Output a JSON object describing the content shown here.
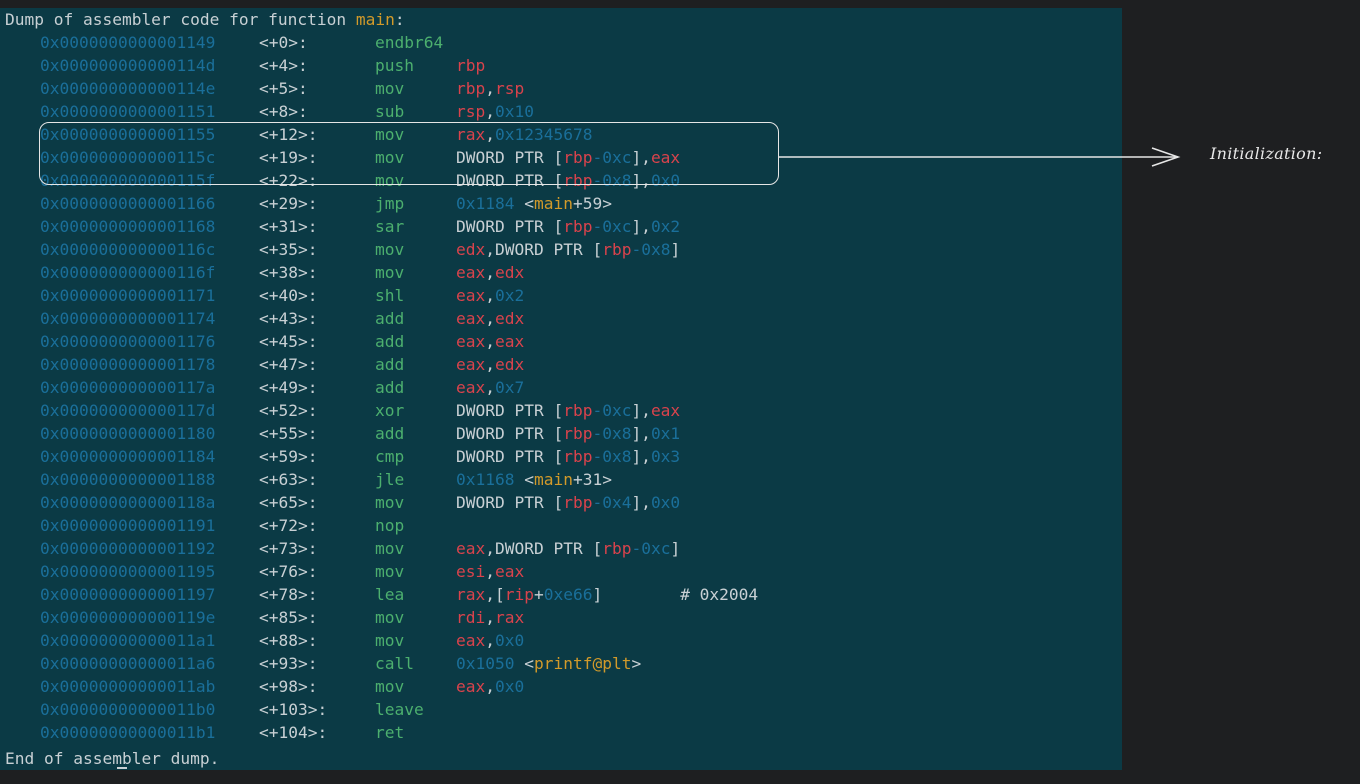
{
  "header": {
    "prefix": "Dump of assembler code for function ",
    "function_name": "main",
    "suffix": ":"
  },
  "footer": "End of assembler dump.",
  "annotation": {
    "label": "Initialization:"
  },
  "rows": [
    {
      "addr": "0x0000000000001149",
      "off": "<+0>:",
      "mn": "endbr64",
      "ops": []
    },
    {
      "addr": "0x000000000000114d",
      "off": "<+4>:",
      "mn": "push",
      "ops": [
        [
          "r",
          "rbp"
        ]
      ]
    },
    {
      "addr": "0x000000000000114e",
      "off": "<+5>:",
      "mn": "mov",
      "ops": [
        [
          "r",
          "rbp"
        ],
        [
          "p",
          ","
        ],
        [
          "r",
          "rsp"
        ]
      ]
    },
    {
      "addr": "0x0000000000001151",
      "off": "<+8>:",
      "mn": "sub",
      "ops": [
        [
          "r",
          "rsp"
        ],
        [
          "p",
          ","
        ],
        [
          "i",
          "0x10"
        ]
      ]
    },
    {
      "addr": "0x0000000000001155",
      "off": "<+12>:",
      "mn": "mov",
      "ops": [
        [
          "r",
          "rax"
        ],
        [
          "p",
          ","
        ],
        [
          "i",
          "0x12345678"
        ]
      ]
    },
    {
      "addr": "0x000000000000115c",
      "off": "<+19>:",
      "mn": "mov",
      "ops": [
        [
          "p",
          "DWORD PTR ["
        ],
        [
          "r",
          "rbp"
        ],
        [
          "i",
          "-0xc"
        ],
        [
          "p",
          "],"
        ],
        [
          "r",
          "eax"
        ]
      ]
    },
    {
      "addr": "0x000000000000115f",
      "off": "<+22>:",
      "mn": "mov",
      "ops": [
        [
          "p",
          "DWORD PTR ["
        ],
        [
          "r",
          "rbp"
        ],
        [
          "i",
          "-0x8"
        ],
        [
          "p",
          "],"
        ],
        [
          "i",
          "0x0"
        ]
      ]
    },
    {
      "addr": "0x0000000000001166",
      "off": "<+29>:",
      "mn": "jmp",
      "ops": [
        [
          "i",
          "0x1184"
        ],
        [
          "p",
          " <"
        ],
        [
          "f",
          "main"
        ],
        [
          "p",
          "+59>"
        ]
      ]
    },
    {
      "addr": "0x0000000000001168",
      "off": "<+31>:",
      "mn": "sar",
      "ops": [
        [
          "p",
          "DWORD PTR ["
        ],
        [
          "r",
          "rbp"
        ],
        [
          "i",
          "-0xc"
        ],
        [
          "p",
          "],"
        ],
        [
          "i",
          "0x2"
        ]
      ]
    },
    {
      "addr": "0x000000000000116c",
      "off": "<+35>:",
      "mn": "mov",
      "ops": [
        [
          "r",
          "edx"
        ],
        [
          "p",
          ",DWORD PTR ["
        ],
        [
          "r",
          "rbp"
        ],
        [
          "i",
          "-0x8"
        ],
        [
          "p",
          "]"
        ]
      ]
    },
    {
      "addr": "0x000000000000116f",
      "off": "<+38>:",
      "mn": "mov",
      "ops": [
        [
          "r",
          "eax"
        ],
        [
          "p",
          ","
        ],
        [
          "r",
          "edx"
        ]
      ]
    },
    {
      "addr": "0x0000000000001171",
      "off": "<+40>:",
      "mn": "shl",
      "ops": [
        [
          "r",
          "eax"
        ],
        [
          "p",
          ","
        ],
        [
          "i",
          "0x2"
        ]
      ]
    },
    {
      "addr": "0x0000000000001174",
      "off": "<+43>:",
      "mn": "add",
      "ops": [
        [
          "r",
          "eax"
        ],
        [
          "p",
          ","
        ],
        [
          "r",
          "edx"
        ]
      ]
    },
    {
      "addr": "0x0000000000001176",
      "off": "<+45>:",
      "mn": "add",
      "ops": [
        [
          "r",
          "eax"
        ],
        [
          "p",
          ","
        ],
        [
          "r",
          "eax"
        ]
      ]
    },
    {
      "addr": "0x0000000000001178",
      "off": "<+47>:",
      "mn": "add",
      "ops": [
        [
          "r",
          "eax"
        ],
        [
          "p",
          ","
        ],
        [
          "r",
          "edx"
        ]
      ]
    },
    {
      "addr": "0x000000000000117a",
      "off": "<+49>:",
      "mn": "add",
      "ops": [
        [
          "r",
          "eax"
        ],
        [
          "p",
          ","
        ],
        [
          "i",
          "0x7"
        ]
      ]
    },
    {
      "addr": "0x000000000000117d",
      "off": "<+52>:",
      "mn": "xor",
      "ops": [
        [
          "p",
          "DWORD PTR ["
        ],
        [
          "r",
          "rbp"
        ],
        [
          "i",
          "-0xc"
        ],
        [
          "p",
          "],"
        ],
        [
          "r",
          "eax"
        ]
      ]
    },
    {
      "addr": "0x0000000000001180",
      "off": "<+55>:",
      "mn": "add",
      "ops": [
        [
          "p",
          "DWORD PTR ["
        ],
        [
          "r",
          "rbp"
        ],
        [
          "i",
          "-0x8"
        ],
        [
          "p",
          "],"
        ],
        [
          "i",
          "0x1"
        ]
      ]
    },
    {
      "addr": "0x0000000000001184",
      "off": "<+59>:",
      "mn": "cmp",
      "ops": [
        [
          "p",
          "DWORD PTR ["
        ],
        [
          "r",
          "rbp"
        ],
        [
          "i",
          "-0x8"
        ],
        [
          "p",
          "],"
        ],
        [
          "i",
          "0x3"
        ]
      ]
    },
    {
      "addr": "0x0000000000001188",
      "off": "<+63>:",
      "mn": "jle",
      "ops": [
        [
          "i",
          "0x1168"
        ],
        [
          "p",
          " <"
        ],
        [
          "f",
          "main"
        ],
        [
          "p",
          "+31>"
        ]
      ]
    },
    {
      "addr": "0x000000000000118a",
      "off": "<+65>:",
      "mn": "mov",
      "ops": [
        [
          "p",
          "DWORD PTR ["
        ],
        [
          "r",
          "rbp"
        ],
        [
          "i",
          "-0x4"
        ],
        [
          "p",
          "],"
        ],
        [
          "i",
          "0x0"
        ]
      ]
    },
    {
      "addr": "0x0000000000001191",
      "off": "<+72>:",
      "mn": "nop",
      "ops": []
    },
    {
      "addr": "0x0000000000001192",
      "off": "<+73>:",
      "mn": "mov",
      "ops": [
        [
          "r",
          "eax"
        ],
        [
          "p",
          ",DWORD PTR ["
        ],
        [
          "r",
          "rbp"
        ],
        [
          "i",
          "-0xc"
        ],
        [
          "p",
          "]"
        ]
      ]
    },
    {
      "addr": "0x0000000000001195",
      "off": "<+76>:",
      "mn": "mov",
      "ops": [
        [
          "r",
          "esi"
        ],
        [
          "p",
          ","
        ],
        [
          "r",
          "eax"
        ]
      ]
    },
    {
      "addr": "0x0000000000001197",
      "off": "<+78>:",
      "mn": "lea",
      "ops": [
        [
          "r",
          "rax"
        ],
        [
          "p",
          ",["
        ],
        [
          "r",
          "rip"
        ],
        [
          "p",
          "+"
        ],
        [
          "i",
          "0xe66"
        ],
        [
          "p",
          "]        # 0x2004"
        ]
      ]
    },
    {
      "addr": "0x000000000000119e",
      "off": "<+85>:",
      "mn": "mov",
      "ops": [
        [
          "r",
          "rdi"
        ],
        [
          "p",
          ","
        ],
        [
          "r",
          "rax"
        ]
      ]
    },
    {
      "addr": "0x00000000000011a1",
      "off": "<+88>:",
      "mn": "mov",
      "ops": [
        [
          "r",
          "eax"
        ],
        [
          "p",
          ","
        ],
        [
          "i",
          "0x0"
        ]
      ]
    },
    {
      "addr": "0x00000000000011a6",
      "off": "<+93>:",
      "mn": "call",
      "ops": [
        [
          "i",
          "0x1050"
        ],
        [
          "p",
          " <"
        ],
        [
          "f",
          "printf@plt"
        ],
        [
          "p",
          ">"
        ]
      ]
    },
    {
      "addr": "0x00000000000011ab",
      "off": "<+98>:",
      "mn": "mov",
      "ops": [
        [
          "r",
          "eax"
        ],
        [
          "p",
          ","
        ],
        [
          "i",
          "0x0"
        ]
      ]
    },
    {
      "addr": "0x00000000000011b0",
      "off": "<+103>:",
      "mn": "leave",
      "ops": []
    },
    {
      "addr": "0x00000000000011b1",
      "off": "<+104>:",
      "mn": "ret",
      "ops": []
    }
  ]
}
